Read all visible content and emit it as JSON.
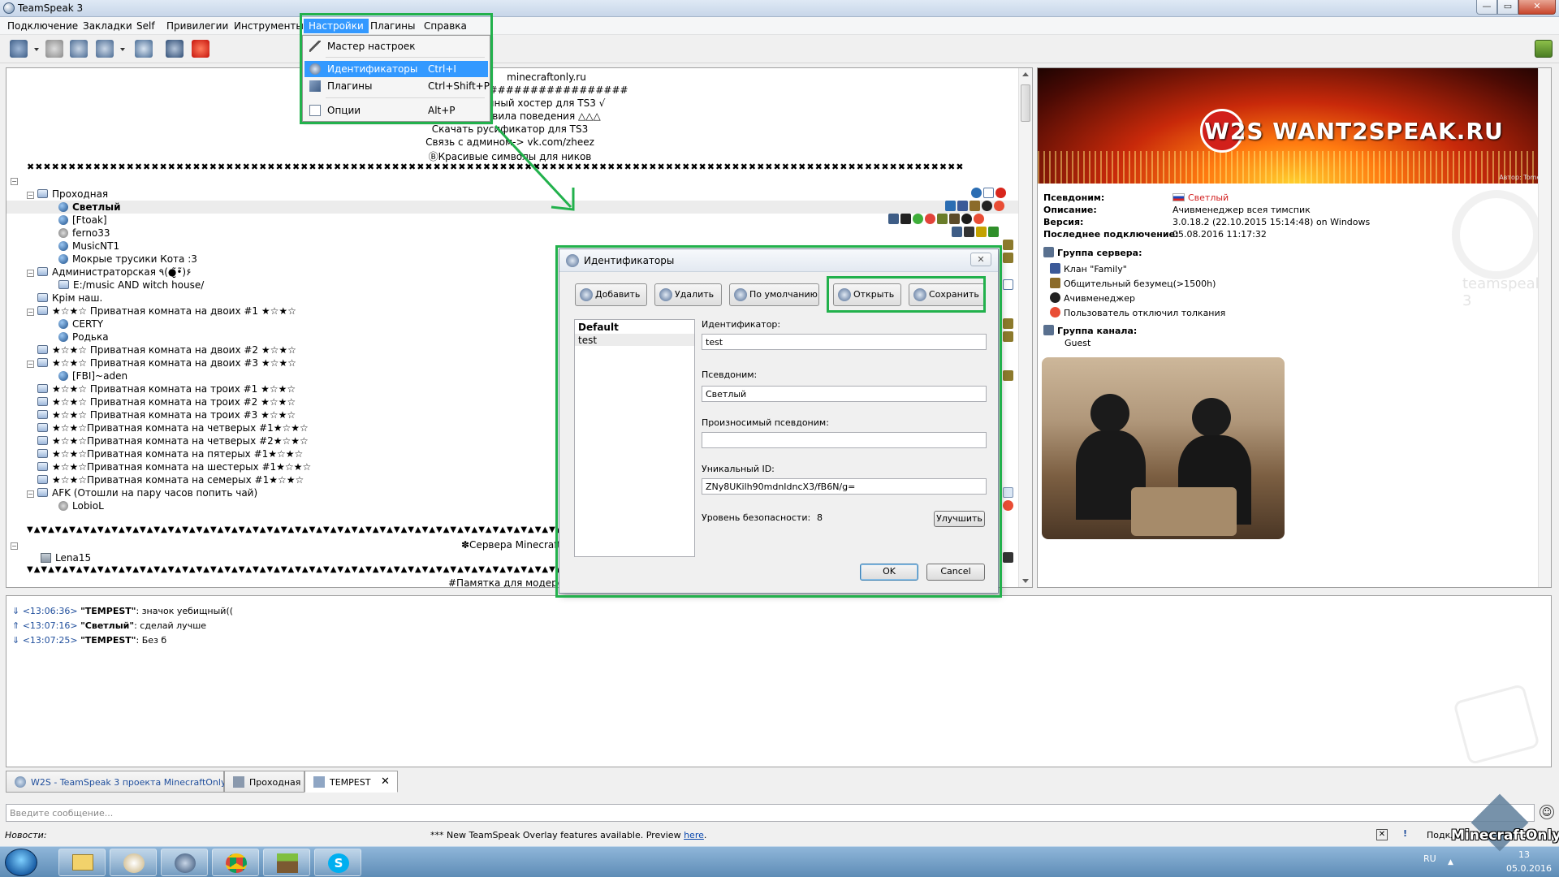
{
  "window": {
    "title": "TeamSpeak 3",
    "min": "0",
    "max": "1",
    "close": "r"
  },
  "menubar": {
    "items": [
      "Подключение",
      "Закладки",
      "Self",
      "Привилегии",
      "Инструменты",
      "Настройки",
      "Плагины",
      "Справка"
    ]
  },
  "settings_menu": {
    "items": [
      {
        "label": "Мастер настроек",
        "shortcut": "",
        "icon": "wand-icon"
      },
      {
        "label": "Идентификаторы",
        "shortcut": "Ctrl+I",
        "icon": "identity-icon"
      },
      {
        "label": "Плагины",
        "shortcut": "Ctrl+Shift+P",
        "icon": "plugin-icon"
      },
      {
        "label": "Опции",
        "shortcut": "Alt+P",
        "icon": "options-icon"
      }
    ]
  },
  "tree": {
    "header_lines": [
      "minecraftonly.ru",
      "####################",
      "нный хостер для TS3 √",
      "вила поведения △△△",
      "Скачать русификатор для TS3",
      "Связь с админом-> vk.com/zheez",
      "ⒷКрасивые символы для ников"
    ],
    "pattern_x": "✖✖✖✖✖✖✖✖✖✖✖✖✖✖✖✖✖✖✖✖✖✖✖✖✖✖✖✖✖✖✖✖✖✖✖✖✖✖✖✖✖✖✖✖✖✖✖✖✖✖✖✖✖✖✖✖✖✖✖✖✖✖✖✖✖✖✖✖✖✖✖✖✖✖✖✖✖✖✖✖✖✖✖✖✖✖✖✖✖✖✖✖✖✖✖✖✖✖✖✖✖✖✖✖✖✖✖✖✖✖✖✖✖",
    "channel_passage": "Проходная",
    "clients_passage": [
      "Светлый",
      "[Ftoak]",
      "ferno33",
      "MusicNT1",
      "Мокрые трусики Кота :3"
    ],
    "channel_admin": "Администраторская ٩(●̮̮̃•̃)۶",
    "admin_sub": "E:/music AND witch house/",
    "channel_krym": "Крім наш.",
    "private2_1": "★☆★☆ Приватная комната на двоих #1 ★☆★☆",
    "private2_1_clients": [
      "CERTY",
      "Родька"
    ],
    "private2_2": "★☆★☆ Приватная комната на двоих #2 ★☆★☆",
    "private2_3": "★☆★☆ Приватная комната на двоих #3 ★☆★☆",
    "private2_3_clients": [
      "[FBI]~aden"
    ],
    "private3": [
      "★☆★☆ Приватная комната на троих #1 ★☆★☆",
      "★☆★☆ Приватная комната на троих #2 ★☆★☆",
      "★☆★☆ Приватная комната на троих #3 ★☆★☆",
      "★☆★☆Приватная комната на четверых #1★☆★☆",
      "★☆★☆Приватная комната на четверых #2★☆★☆",
      "★☆★☆Приватная комната на пятерых #1★☆★☆",
      "★☆★☆Приватная комната на шестерых #1★☆★☆",
      "★☆★☆Приватная комната на семерых #1★☆★☆"
    ],
    "channel_afk": "AFK (Отошли на пару часов попить чай)",
    "afk_clients": [
      "LobioL"
    ],
    "pattern_triangles": "▼▲▼▲▼▲▼▲▼▲▼▲▼▲▼▲▼▲▼▲▼▲▼▲▼▲▼▲▼▲▼▲▼▲▼▲▼▲▼▲▼▲▼▲▼▲▼▲▼▲▼▲▼▲▼▲▼▲▼▲▼▲▼▲▼▲▼▲▼▲▼▲▼▲▼▲▼▲▼▲▼▲▼▲▼▲▼▲▼▲▼▲▼▲▼▲▼▲▼▲",
    "minecraft_servers": "✽Сервера MinecraftO",
    "lena": "Lena15",
    "moders_memo": "#Памятка для модеров #"
  },
  "dialog": {
    "title": "Идентификаторы",
    "close": "✕",
    "buttons": {
      "add": "Добавить",
      "remove": "Удалить",
      "default": "По умолчанию",
      "open": "Открыть",
      "save": "Сохранить"
    },
    "list": [
      "Default",
      "test"
    ],
    "fields": {
      "identity_label": "Идентификатор:",
      "identity_value": "test",
      "nickname_label": "Псевдоним:",
      "nickname_value": "Светлый",
      "phonetic_label": "Произносимый псевдоним:",
      "phonetic_value": "",
      "uid_label": "Уникальный ID:",
      "uid_value": "ZNy8UKilh90mdnIdncX3/fB6N/g=",
      "security_label": "Уровень безопасности:",
      "security_value": "8",
      "improve_button": "Улучшить"
    },
    "ok": "OK",
    "cancel": "Cancel"
  },
  "info": {
    "banner_text": "W2S WANT2SPEAK.RU",
    "banner_credit": "Автор: Tomex",
    "nickname_k": "Псевдоним:",
    "nickname_v": "Светлый",
    "desc_k": "Описание:",
    "desc_v": "Ачивменеджер всея тимспик",
    "version_k": "Версия:",
    "version_v": "3.0.18.2 (22.10.2015 15:14:48) on Windows",
    "last_k": "Последнее подключение:",
    "last_v": "05.08.2016 11:17:32",
    "server_group_k": "Группа сервера:",
    "server_groups": [
      "Клан \"Family\"",
      "Общительный безумец(>1500h)",
      "Ачивменеджер",
      "Пользователь отключил толкания"
    ],
    "channel_group_k": "Группа канала:",
    "channel_group_v": "Guest",
    "watermark": "teamspeak 3"
  },
  "chat": {
    "lines": [
      {
        "time": "<13:06:36>",
        "nick": "\"TEMPEST\"",
        "text": ": значок уебищный(("
      },
      {
        "time": "<13:07:16>",
        "nick": "\"Светлый\"",
        "text": ": сделай лучше"
      },
      {
        "time": "<13:07:25>",
        "nick": "\"TEMPEST\"",
        "text": ": Без б"
      }
    ]
  },
  "tabs": [
    {
      "label": "W2S - TeamSpeak 3 проекта MinecraftOnly.ru"
    },
    {
      "label": "Проходная"
    },
    {
      "label": "TEMPEST"
    }
  ],
  "tab_close": "✕",
  "input": {
    "placeholder": "Введите сообщение..."
  },
  "emoji": "☺",
  "news": {
    "label": "Новости:",
    "text": "*** New TeamSpeak Overlay features available. Preview",
    "link": "here",
    "end": ".",
    "close": "✕",
    "warn": "!",
    "right": "Подкл"
  },
  "taskbar": {
    "lang": "RU",
    "time": "13",
    "date": "05.0.2016",
    "watermark": "MinecraftOnly"
  }
}
